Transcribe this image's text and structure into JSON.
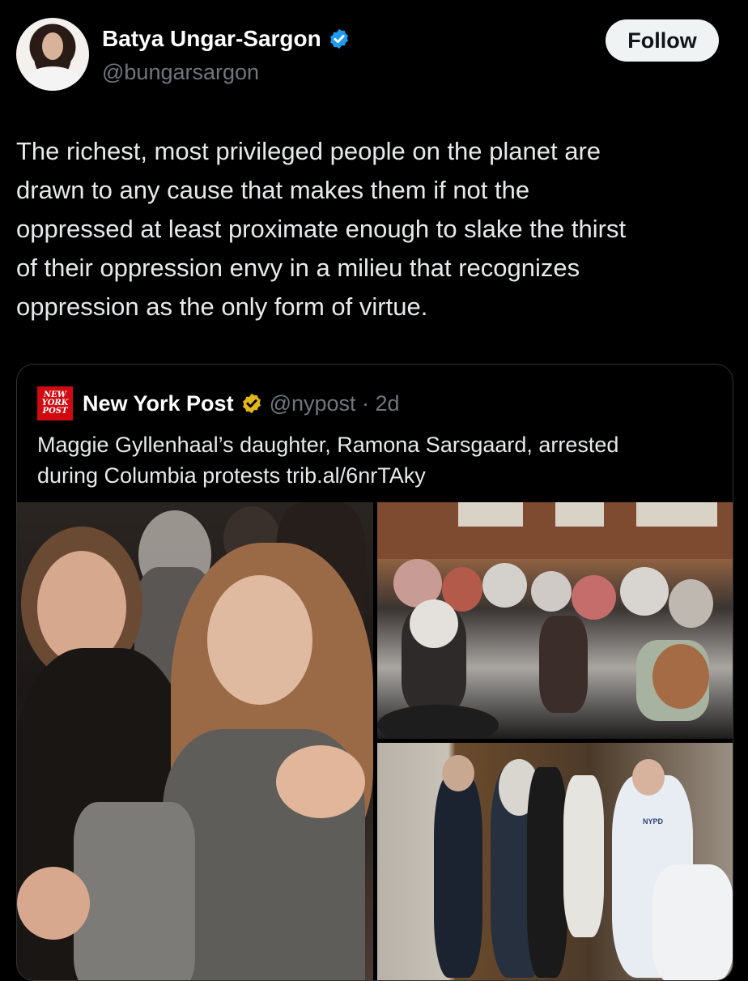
{
  "author": {
    "name": "Batya Ungar-Sargon",
    "handle": "@bungarsargon",
    "follow_label": "Follow"
  },
  "tweet": {
    "lines": [
      "The richest, most privileged people on the planet are",
      "drawn to any cause that makes them if not the",
      "oppressed at least proximate enough to slake the thirst",
      "of their oppression envy in a milieu that recognizes",
      "oppression as the only form of virtue."
    ]
  },
  "quoted": {
    "logo_lines": [
      "NEW",
      "YORK",
      "POST"
    ],
    "name": "New York Post",
    "handle_time": "@nypost · 2d",
    "text_lines": [
      "Maggie Gyllenhaal’s daughter, Ramona Sarsgaard, arrested",
      "during Columbia protests trib.al/6nrTAky"
    ],
    "photo_badge": "NYPD"
  },
  "colors": {
    "background": "#000000",
    "verified_blue": "#1d9bf0",
    "verified_gold": "#e2b719",
    "nypost_red": "#d10a11"
  }
}
